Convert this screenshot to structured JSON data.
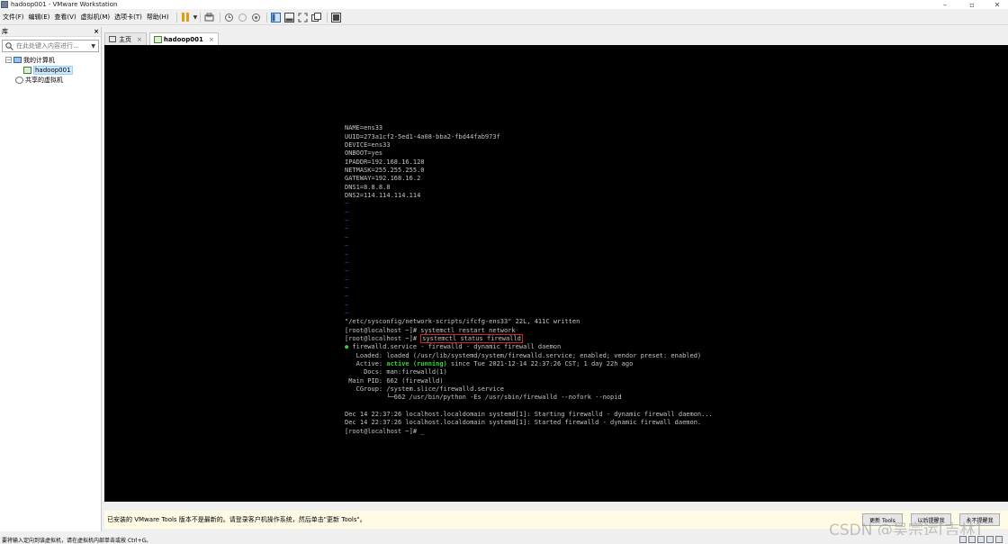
{
  "window": {
    "title": "hadoop001 - VMware Workstation",
    "controls": {
      "minimize": "–",
      "maximize": "▫",
      "close": "✕"
    }
  },
  "menu": {
    "items": [
      "文件(F)",
      "编辑(E)",
      "查看(V)",
      "虚拟机(M)",
      "选项卡(T)",
      "帮助(H)"
    ]
  },
  "toolbar": {
    "icons": [
      "pause-icon",
      "send-ctrl-alt-del-icon",
      "snapshot-icon",
      "revert-snapshot-icon",
      "snapshot-manager-icon",
      "library-view-icon",
      "thumbnail-view-icon",
      "fullscreen-icon",
      "unity-icon",
      "console-view-icon"
    ],
    "accent": "#e39d10"
  },
  "library": {
    "title": "库",
    "close": "×",
    "search_placeholder": "在此处键入内容进行...",
    "tree": {
      "root": "我的计算机",
      "vm": "hadoop001",
      "shared": "共享的虚拟机"
    }
  },
  "tabs": [
    {
      "label": "主页",
      "close": "×"
    },
    {
      "label": "hadoop001",
      "close": "×"
    }
  ],
  "terminal": {
    "config_lines": [
      "NAME=ens33",
      "UUID=273a1cf2-5ed1-4a08-bba2-fbd44fab973f",
      "DEVICE=ens33",
      "ONBOOT=yes",
      "IPADDR=192.168.16.128",
      "NETMASK=255.255.255.0",
      "GATEWAY=192.168.16.2",
      "DNS1=8.8.8.8",
      "DNS2=114.114.114.114"
    ],
    "tilde_lines": [
      "~",
      "~",
      "~",
      "~",
      "~",
      "~",
      "~",
      "~",
      "~",
      "~",
      "~",
      "~",
      "~",
      "~"
    ],
    "written": "\"/etc/sysconfig/network-scripts/ifcfg-ens33\" 22L, 411C written",
    "prompt1": "[root@localhost ~]# systemctl restart network",
    "prompt2": "[root@localhost ~]# ",
    "highlighted_cmd": "systemctl status firewalld",
    "service_dot": "●",
    "service_line": " firewalld.service - firewalld - dynamic firewall daemon",
    "loaded": "   Loaded: loaded (/usr/lib/systemd/system/firewalld.service; enabled; vendor preset: enabled)",
    "active_prefix": "   Active: ",
    "active_state": "active (running)",
    "active_suffix": " since Tue 2021-12-14 22:37:26 CST; 1 day 22h ago",
    "docs": "     Docs: man:firewalld(1)",
    "mainpid": " Main PID: 662 (firewalld)",
    "cgroup": "   CGroup: /system.slice/firewalld.service",
    "cgroup_child": "           └─662 /usr/bin/python -Es /usr/sbin/firewalld --nofork --nopid",
    "log1": "Dec 14 22:37:26 localhost.localdomain systemd[1]: Starting firewalld - dynamic firewall daemon...",
    "log2": "Dec 14 22:37:26 localhost.localdomain systemd[1]: Started firewalld - dynamic firewall daemon.",
    "final_prompt": "[root@localhost ~]# _"
  },
  "notification": {
    "text": "已安装的 VMware Tools 版本不是最新的。请登录客户机操作系统，然后单击\"更新 Tools\"。",
    "update_button": "更新 Tools",
    "remind_button": "以后提醒我",
    "never_button": "永不提醒我"
  },
  "watermark": "CSDN @吴宗运[吉林]",
  "status_bar": {
    "text": "要将输入定向到该虚拟机，请在虚拟机内部单击或按 Ctrl+G。"
  }
}
